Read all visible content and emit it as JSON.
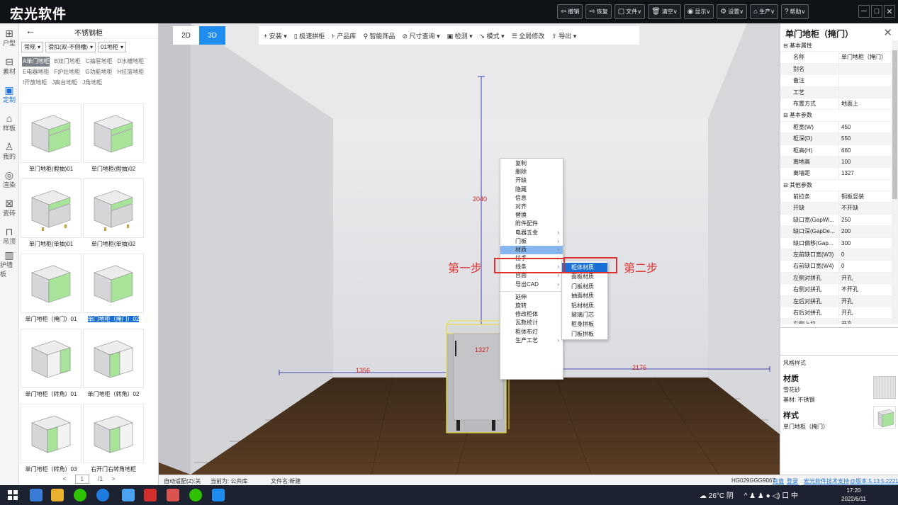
{
  "app": {
    "title": "宏光软件",
    "toolbar_buttons": [
      {
        "icon": "undo-icon",
        "glyph": "⇦",
        "label": "撤销"
      },
      {
        "icon": "redo-icon",
        "glyph": "⇨",
        "label": "恢复"
      },
      {
        "icon": "file-icon",
        "glyph": "▢",
        "label": "文件∨"
      },
      {
        "icon": "trash-icon",
        "glyph": "🗑",
        "label": "清空∨"
      },
      {
        "icon": "eye-icon",
        "glyph": "◉",
        "label": "显示∨"
      },
      {
        "icon": "gear-icon",
        "glyph": "⚙",
        "label": "设置∨"
      },
      {
        "icon": "produce-icon",
        "glyph": "⌂",
        "label": "生产∨"
      },
      {
        "icon": "help-icon",
        "glyph": "?",
        "label": "帮助∨"
      }
    ],
    "window_controls": [
      "─",
      "□",
      "✕"
    ]
  },
  "rail": [
    {
      "icon": "floorplan-icon",
      "glyph": "⊞",
      "label": "户型"
    },
    {
      "icon": "material-icon",
      "glyph": "⊟",
      "label": "素材"
    },
    {
      "icon": "custom-icon",
      "glyph": "▣",
      "label": "定制",
      "active": true
    },
    {
      "icon": "template-icon",
      "glyph": "⌂",
      "label": "样板"
    },
    {
      "icon": "user-icon",
      "glyph": "♙",
      "label": "我的"
    },
    {
      "icon": "camera-icon",
      "glyph": "◎",
      "label": "渲染"
    },
    {
      "icon": "tile-icon",
      "glyph": "⊠",
      "label": "瓷砖"
    },
    {
      "icon": "ceiling-icon",
      "glyph": "⊓",
      "label": "吊顶"
    },
    {
      "icon": "wallboard-icon",
      "glyph": "▥",
      "label": "护墙板"
    }
  ],
  "catalog": {
    "title": "不锈钢柜",
    "filters": [
      "常规",
      "滑扣(双-不侧槽)",
      "01地柜"
    ],
    "tags": [
      "A单门地柜",
      "B双门地柜",
      "C抽屉地柜",
      "D水槽地柜",
      "E电器地柜",
      "F炉灶地柜",
      "G功能地柜",
      "H拉篮地柜",
      "I开放地柜",
      "J高台地柜",
      "J角地柜"
    ],
    "active_tag": 0,
    "items": [
      {
        "label": "单门地柜(假抽)01",
        "variant": "drawer-left"
      },
      {
        "label": "单门地柜(假抽)02",
        "variant": "drawer-right"
      },
      {
        "label": "单门地柜(单抽)01",
        "variant": "open-top"
      },
      {
        "label": "单门地柜(单抽)02",
        "variant": "open-top2"
      },
      {
        "label": "单门地柜（掩门）01",
        "variant": "door-left"
      },
      {
        "label": "单门地柜（掩门）02",
        "variant": "door-right",
        "selected": true
      },
      {
        "label": "单门地柜（转角）01",
        "variant": "corner-a"
      },
      {
        "label": "单门地柜（转角）02",
        "variant": "corner-b"
      },
      {
        "label": "单门地柜（转角）03",
        "variant": "corner-c"
      },
      {
        "label": "右开门右转角地柜",
        "variant": "corner-d"
      }
    ],
    "pager": {
      "prev": "<",
      "page": "1",
      "total": "/1",
      "next": ">"
    }
  },
  "viewport": {
    "tabs": [
      "2D",
      "3D"
    ],
    "active_tab": "3D",
    "tools": [
      "+ 安装 ▾",
      "▯ 极速拼柜",
      "⊦ 产品库",
      "⚲ 智能饰品",
      "⊘ 尺寸查询 ▾",
      "▣ 检测 ▾",
      "➘ 模式 ▾",
      "☰ 全局修改",
      "⇪ 导出 ▾"
    ],
    "dims": {
      "height": "2040",
      "left": "1356",
      "right": "2176",
      "cabinet": "1327"
    },
    "step1": "第一步",
    "step2": "第二步"
  },
  "context_menu": {
    "items": [
      "复制",
      "删除",
      "开缺",
      "隐藏",
      "信息",
      "对齐",
      "替换",
      "附件配件",
      "电器五金",
      "门板",
      "材质",
      "拉手",
      "线条",
      "台面",
      "导出CAD",
      "延伸",
      "旋转",
      "修改柜体",
      "瓦数统计",
      "柜体布灯",
      "生产工艺"
    ],
    "submenu_items": [
      8,
      9,
      10,
      11,
      12,
      13,
      14,
      20
    ],
    "separators_after": [
      14
    ],
    "highlighted": 10,
    "submenu": [
      "柜体材质",
      "面板材质",
      "门板材质",
      "抽面材质",
      "铝材材质",
      "玻璃门芯",
      "柜身拼板",
      "门板拼板"
    ],
    "submenu_highlighted": 0
  },
  "properties": {
    "title": "单门地柜（掩门）",
    "rows": [
      {
        "group": "基本属性"
      },
      {
        "k": "名称",
        "v": "单门地柜（掩门）"
      },
      {
        "k": "别名",
        "v": ""
      },
      {
        "k": "备注",
        "v": ""
      },
      {
        "k": "工艺",
        "v": ""
      },
      {
        "k": "布置方式",
        "v": "地面上"
      },
      {
        "group": "基本参数"
      },
      {
        "k": "柜宽(W)",
        "v": "450"
      },
      {
        "k": "柜深(D)",
        "v": "550"
      },
      {
        "k": "柜高(H)",
        "v": "660"
      },
      {
        "k": "离地高",
        "v": "100"
      },
      {
        "k": "离墙距",
        "v": "1327"
      },
      {
        "group": "其他参数"
      },
      {
        "k": "前拉条",
        "v": "铜板竖装"
      },
      {
        "k": "开缺",
        "v": "不开缺"
      },
      {
        "k": "缺口宽(GapWi...",
        "v": "250"
      },
      {
        "k": "缺口深(GapDe...",
        "v": "200"
      },
      {
        "k": "缺口偏移(Gap...",
        "v": "300"
      },
      {
        "k": "左前缺口宽(W3)",
        "v": "0"
      },
      {
        "k": "右前缺口宽(W4)",
        "v": "0"
      },
      {
        "k": "左侧对拼孔",
        "v": "开孔"
      },
      {
        "k": "右侧对拼孔",
        "v": "不开孔"
      },
      {
        "k": "左后对拼孔",
        "v": "开孔"
      },
      {
        "k": "右后对拼孔",
        "v": "开孔"
      },
      {
        "k": "左侧上拉",
        "v": "开孔"
      }
    ],
    "style_title": "风格样式",
    "material_heading": "材质",
    "material_name": "雪花砂",
    "base_material": "基材: 不锈钢",
    "style_heading": "样式",
    "style_name": "单门地柜（掩门）"
  },
  "status": {
    "auto_fit": "自动适配(Z):关",
    "current": "当前为: 公共库",
    "filename": "文件名:新建",
    "code": "HG029GGG9067",
    "recharge": "充值",
    "login": "登录",
    "support": "宏光软件技术支持",
    "version": "@版本:5.13.5.2221"
  },
  "taskbar": {
    "weather": "☁ 26°C 阴",
    "tray": "^ ♟ ♟ ● ◁) 口 中",
    "time": "17:20",
    "date": "2022/6/11"
  }
}
